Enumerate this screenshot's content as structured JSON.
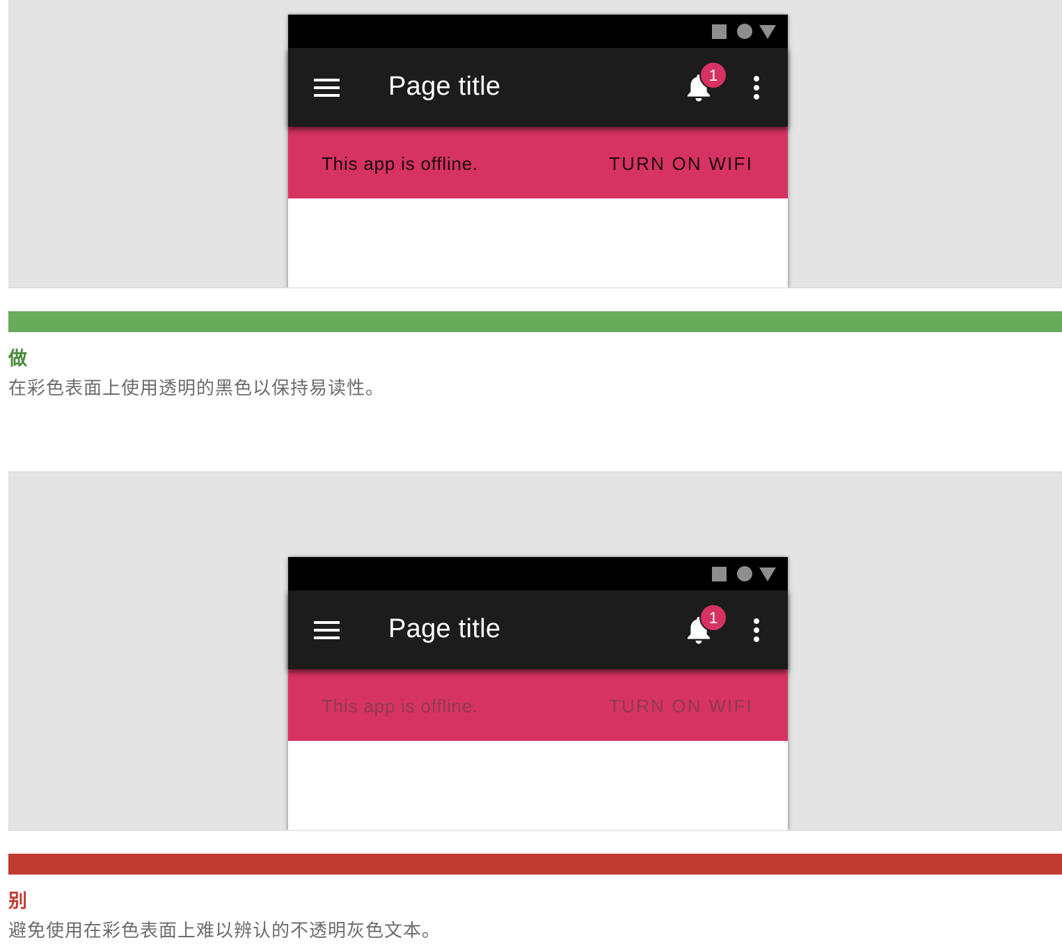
{
  "examples": [
    {
      "phone": {
        "title": "Page title",
        "notification_count": "1",
        "banner_text": "This app is offline.",
        "banner_action": "TURN ON WIFI"
      },
      "verdict": {
        "label": "做",
        "color": "#68ab5b"
      },
      "caption": "在彩色表面上使用透明的黑色以保持易读性。"
    },
    {
      "phone": {
        "title": "Page title",
        "notification_count": "1",
        "banner_text": "This app is offline.",
        "banner_action": "TURN ON WIFI"
      },
      "verdict": {
        "label": "别",
        "color": "#c13b33"
      },
      "caption": "避免使用在彩色表面上难以辨认的不透明灰色文本。"
    }
  ],
  "colors": {
    "status_bar": "#000000",
    "app_bar": "#1c1c1c",
    "banner": "#d63262",
    "stage_background": "#e4e4e4",
    "status_icons": "#8e8e8e"
  }
}
